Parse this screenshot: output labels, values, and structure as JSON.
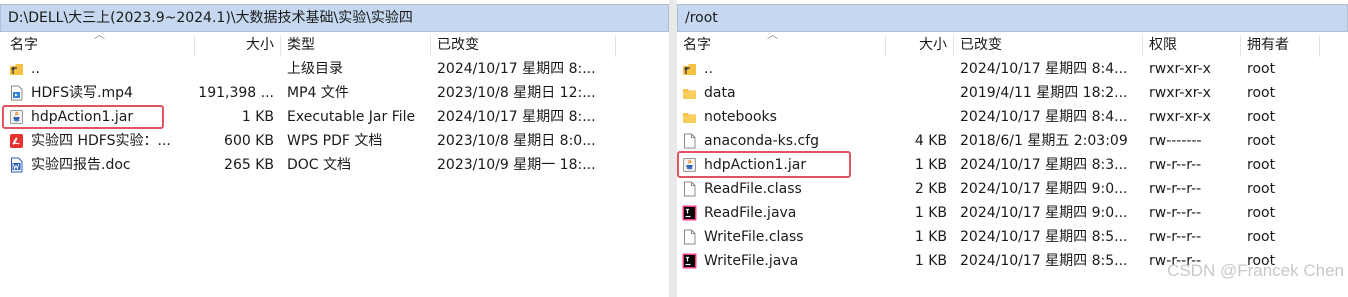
{
  "left": {
    "path": "D:\\DELL\\大三上(2023.9~2024.1)\\大数据技术基础\\实验\\实验四",
    "columns": {
      "name": "名字",
      "size": "大小",
      "type": "类型",
      "modified": "已改变"
    },
    "rows": [
      {
        "name": "..",
        "size": "",
        "type": "上级目录",
        "modified": "2024/10/17 星期四 8:...",
        "icon": "parent-folder-icon"
      },
      {
        "name": "HDFS读写.mp4",
        "size": "191,398 ...",
        "type": "MP4 文件",
        "modified": "2023/10/8 星期日 12:...",
        "icon": "video-file-icon"
      },
      {
        "name": "hdpAction1.jar",
        "size": "1 KB",
        "type": "Executable Jar File",
        "modified": "2024/10/17 星期四 8:...",
        "icon": "java-jar-icon"
      },
      {
        "name": "实验四 HDFS实验：...",
        "size": "600 KB",
        "type": "WPS PDF 文档",
        "modified": "2023/10/8 星期日 8:0...",
        "icon": "pdf-file-icon"
      },
      {
        "name": "实验四报告.doc",
        "size": "265 KB",
        "type": "DOC 文档",
        "modified": "2023/10/9 星期一 18:...",
        "icon": "word-doc-icon"
      }
    ]
  },
  "right": {
    "path": "/root",
    "columns": {
      "name": "名字",
      "size": "大小",
      "modified": "已改变",
      "permissions": "权限",
      "owner": "拥有者"
    },
    "rows": [
      {
        "name": "..",
        "size": "",
        "modified": "2024/10/17 星期四 8:4...",
        "permissions": "rwxr-xr-x",
        "owner": "root",
        "icon": "parent-folder-icon"
      },
      {
        "name": "data",
        "size": "",
        "modified": "2019/4/11 星期四 18:2...",
        "permissions": "rwxr-xr-x",
        "owner": "root",
        "icon": "folder-icon"
      },
      {
        "name": "notebooks",
        "size": "",
        "modified": "2024/10/17 星期四 8:4...",
        "permissions": "rwxr-xr-x",
        "owner": "root",
        "icon": "folder-icon"
      },
      {
        "name": "anaconda-ks.cfg",
        "size": "4 KB",
        "modified": "2018/6/1 星期五 2:03:09",
        "permissions": "rw-------",
        "owner": "root",
        "icon": "file-icon"
      },
      {
        "name": "hdpAction1.jar",
        "size": "1 KB",
        "modified": "2024/10/17 星期四 8:3...",
        "permissions": "rw-r--r--",
        "owner": "root",
        "icon": "java-jar-icon"
      },
      {
        "name": "ReadFile.class",
        "size": "2 KB",
        "modified": "2024/10/17 星期四 9:0...",
        "permissions": "rw-r--r--",
        "owner": "root",
        "icon": "file-icon"
      },
      {
        "name": "ReadFile.java",
        "size": "1 KB",
        "modified": "2024/10/17 星期四 9:0...",
        "permissions": "rw-r--r--",
        "owner": "root",
        "icon": "intellij-java-icon"
      },
      {
        "name": "WriteFile.class",
        "size": "1 KB",
        "modified": "2024/10/17 星期四 8:5...",
        "permissions": "rw-r--r--",
        "owner": "root",
        "icon": "file-icon"
      },
      {
        "name": "WriteFile.java",
        "size": "1 KB",
        "modified": "2024/10/17 星期四 8:5...",
        "permissions": "rw-r--r--",
        "owner": "root",
        "icon": "intellij-java-icon"
      }
    ]
  },
  "watermark": "CSDN @Francek Chen",
  "colors": {
    "path_bar": "#c5d8ef",
    "highlight": "#e0545f",
    "folder": "#f5c244"
  }
}
